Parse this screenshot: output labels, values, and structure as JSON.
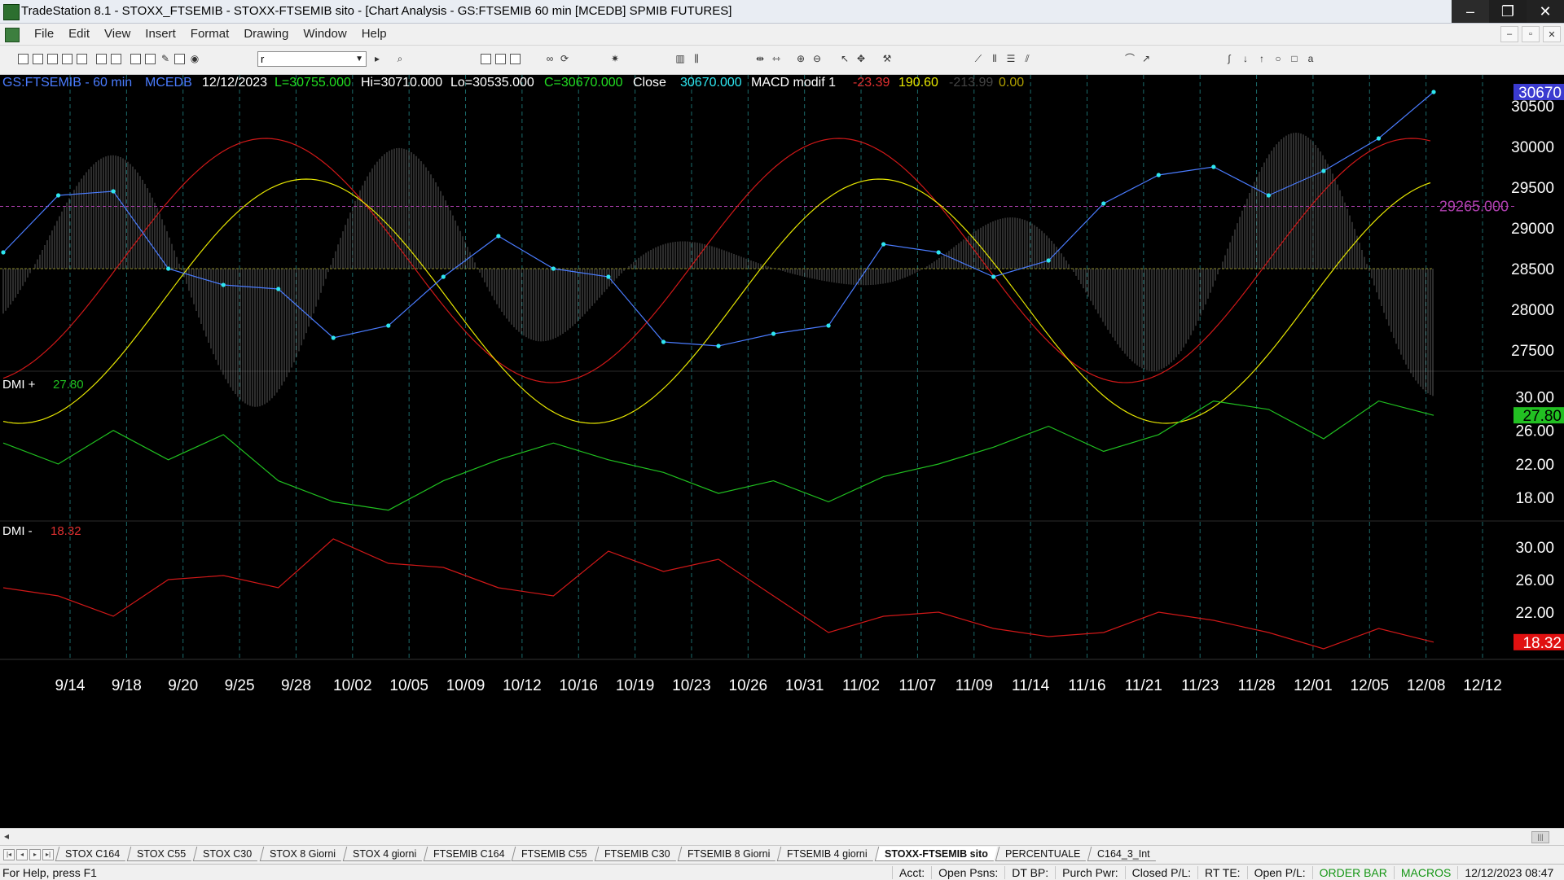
{
  "window": {
    "title": "TradeStation 8.1 - STOXX_FTSEMIB - STOXX-FTSEMIB sito - [Chart Analysis - GS:FTSEMIB  60 min  [MCEDB] SPMIB FUTURES]",
    "minimize": "–",
    "restore": "❐",
    "close": "✕"
  },
  "menu": {
    "items": [
      "File",
      "Edit",
      "View",
      "Insert",
      "Format",
      "Drawing",
      "Window",
      "Help"
    ],
    "mdi": [
      "–",
      "▫",
      "✕"
    ]
  },
  "toolbar": {
    "symbol_value": "r"
  },
  "header": {
    "symbol": "GS:FTSEMIB - 60 min",
    "dataset": "MCEDB",
    "date": "12/12/2023",
    "last": "L=30755.000",
    "high": "Hi=30710.000",
    "low": "Lo=30535.000",
    "close": "C=30670.000",
    "close_label": "Close",
    "close_value": "30670.000",
    "macd_label": "MACD modif 1",
    "macd_v1": "-23.39",
    "macd_v2": "190.60",
    "macd_v3": "-213.99",
    "macd_v4": "0.00"
  },
  "dmi_plus": {
    "label": "DMI +",
    "value": "27.80"
  },
  "dmi_minus": {
    "label": "DMI -",
    "value": "18.32"
  },
  "price_badge": "30670",
  "level_label": "29265.000",
  "colors": {
    "price": "#2ee6f0",
    "red": "#d01818",
    "yellow": "#e6e600",
    "green": "#20c020",
    "grid": "#1b6a6a",
    "hist": "#8a8a8a",
    "magenta": "#b040b0"
  },
  "chart_data": [
    {
      "type": "line",
      "panel": "price",
      "yticks": [
        30500,
        30000,
        29500,
        29000,
        28500,
        28000,
        27500
      ],
      "ylim": [
        27300,
        30800
      ],
      "x": [
        "9/14",
        "9/18",
        "9/20",
        "9/25",
        "9/28",
        "10/02",
        "10/05",
        "10/09",
        "10/12",
        "10/16",
        "10/19",
        "10/23",
        "10/26",
        "10/31",
        "11/02",
        "11/07",
        "11/09",
        "11/14",
        "11/16",
        "11/21",
        "11/23",
        "11/28",
        "12/01",
        "12/05",
        "12/08",
        "12/12"
      ],
      "series": [
        {
          "values": [
            28700,
            29400,
            29450,
            28500,
            28300,
            28250,
            27650,
            27800,
            28400,
            28900,
            28500,
            28400,
            27600,
            27550,
            27700,
            27800,
            28800,
            28700,
            28400,
            28600,
            29300,
            29650,
            29750,
            29400,
            29700,
            30100,
            30670
          ]
        }
      ],
      "reference_level": 29265
    },
    {
      "type": "line",
      "panel": "dmi_plus",
      "yticks": [
        30.0,
        26.0,
        22.0,
        18.0
      ],
      "ylim": [
        15.5,
        31.5
      ],
      "series": [
        {
          "values": [
            24.5,
            22.0,
            26.0,
            22.5,
            25.5,
            20.0,
            17.5,
            16.5,
            20.0,
            22.5,
            24.5,
            22.5,
            21.0,
            18.5,
            20.0,
            17.5,
            20.5,
            22.0,
            24.0,
            26.5,
            23.5,
            25.5,
            29.5,
            28.5,
            25.0,
            29.5,
            27.8
          ]
        }
      ]
    },
    {
      "type": "line",
      "panel": "dmi_minus",
      "yticks": [
        30.0,
        26.0,
        22.0
      ],
      "ylim": [
        16.5,
        32.0
      ],
      "series": [
        {
          "values": [
            25.0,
            24.0,
            21.5,
            26.0,
            26.5,
            25.0,
            31.0,
            28.0,
            27.5,
            25.0,
            24.0,
            29.5,
            27.0,
            28.5,
            24.0,
            19.5,
            21.5,
            22.0,
            20.0,
            19.0,
            19.5,
            22.0,
            21.0,
            19.5,
            17.5,
            20.0,
            18.32
          ]
        }
      ]
    }
  ]
}
